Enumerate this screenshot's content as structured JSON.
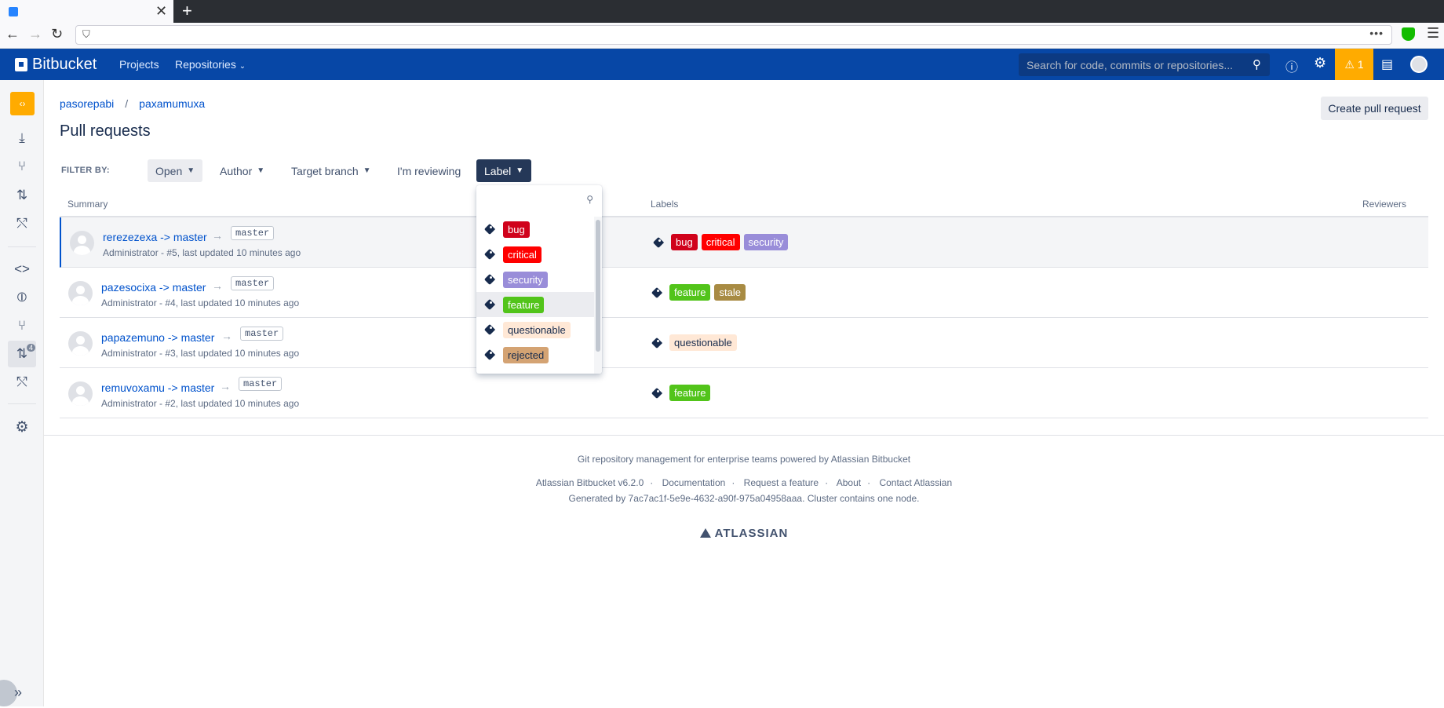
{
  "browser": {
    "new_tab": "+",
    "close_tab": "✕",
    "menu_dots": "•••"
  },
  "header": {
    "product": "Bitbucket",
    "nav": [
      "Projects",
      "Repositories"
    ],
    "search_placeholder": "Search for code, commits or repositories...",
    "warning_count": "1"
  },
  "sidebar": {
    "pr_badge": "4"
  },
  "breadcrumb": {
    "project": "pasorepabi",
    "repo": "paxamumuxa",
    "separator": "/"
  },
  "page_title": "Pull requests",
  "create_button": "Create pull request",
  "filter": {
    "label": "FILTER BY:",
    "state": "Open",
    "author": "Author",
    "target_branch": "Target branch",
    "reviewing": "I'm reviewing",
    "label_filter": "Label"
  },
  "table": {
    "headers": {
      "summary": "Summary",
      "labels": "Labels",
      "reviewers": "Reviewers"
    },
    "rows": [
      {
        "title": "rerezezexa -> master",
        "branch": "master",
        "meta": "Administrator - #5, last updated 10 minutes ago",
        "labels": [
          "bug",
          "critical",
          "security"
        ]
      },
      {
        "title": "pazesocixa -> master",
        "branch": "master",
        "meta": "Administrator - #4, last updated 10 minutes ago",
        "labels": [
          "feature",
          "stale"
        ]
      },
      {
        "title": "papazemuno -> master",
        "branch": "master",
        "meta": "Administrator - #3, last updated 10 minutes ago",
        "labels": [
          "questionable"
        ]
      },
      {
        "title": "remuvoxamu -> master",
        "branch": "master",
        "meta": "Administrator - #2, last updated 10 minutes ago",
        "labels": [
          "feature"
        ]
      }
    ]
  },
  "label_dropdown": {
    "search_value": "",
    "options": [
      "bug",
      "critical",
      "security",
      "feature",
      "questionable",
      "rejected"
    ],
    "highlighted": "feature"
  },
  "footer": {
    "tagline": "Git repository management for enterprise teams powered by Atlassian Bitbucket",
    "version": "Atlassian Bitbucket v6.2.0",
    "links": [
      "Documentation",
      "Request a feature",
      "About",
      "Contact Atlassian"
    ],
    "generated": "Generated by 7ac7ac1f-5e9e-4632-a90f-975a04958aaa. Cluster contains one node.",
    "brand": "ATLASSIAN"
  },
  "colors": {
    "header_bg": "#0747a6",
    "warning": "#ffab00",
    "bug": "#d0021b",
    "critical": "#ff0000",
    "security": "#998dd9",
    "feature": "#52c41a",
    "stale": "#a88b43",
    "questionable": "#ffe8d6",
    "rejected": "#d4a373"
  }
}
